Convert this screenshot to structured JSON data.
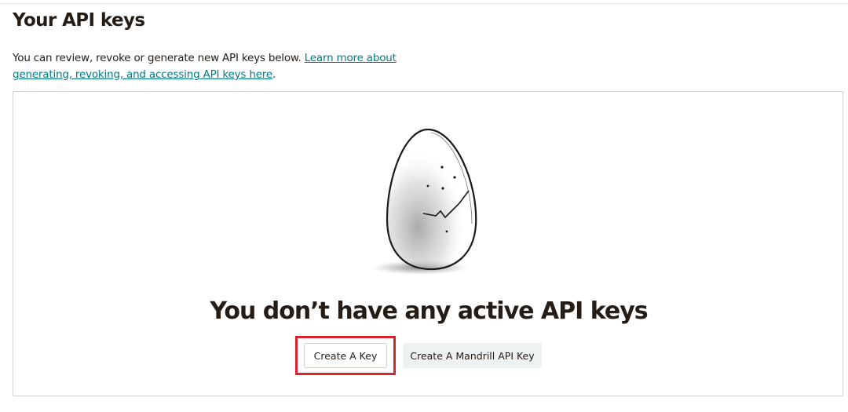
{
  "page": {
    "title": "Your API keys"
  },
  "intro": {
    "text": "You can review, revoke or generate new API keys below. ",
    "link_text": "Learn more about generating, revoking, and accessing API keys here",
    "trailing": "."
  },
  "empty_state": {
    "illustration": "cracked-egg-illustration",
    "heading": "You don’t have any active API keys"
  },
  "actions": {
    "create_key_label": "Create A Key",
    "create_mandrill_label": "Create A Mandrill API Key"
  },
  "colors": {
    "link": "#007c89",
    "highlight": "#d9232d",
    "text": "#241c15",
    "secondary_button_bg": "#eff2f3"
  }
}
